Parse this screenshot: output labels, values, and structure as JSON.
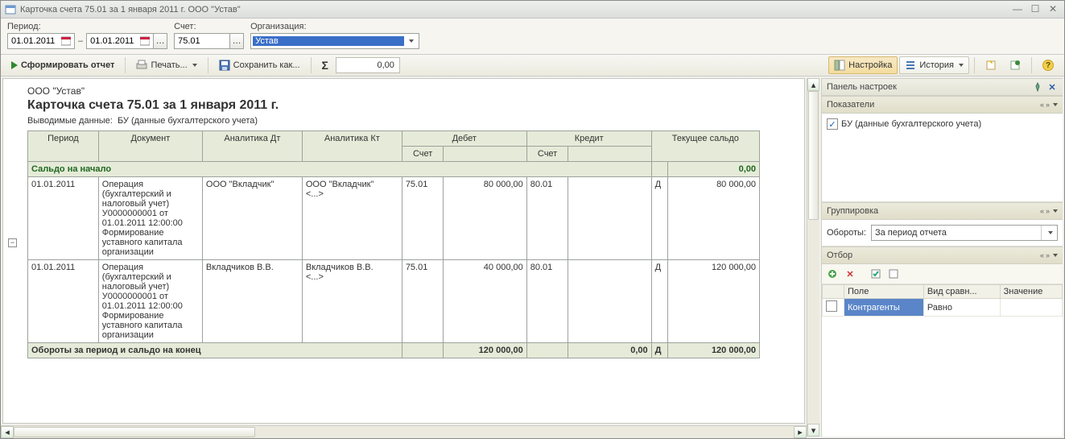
{
  "window": {
    "title": "Карточка счета 75.01 за 1 января 2011 г. ООО \"Устав\""
  },
  "filter": {
    "period_label": "Период:",
    "date_from": "01.01.2011",
    "date_to": "01.01.2011",
    "account_label": "Счет:",
    "account": "75.01",
    "org_label": "Организация:",
    "org": "Устав"
  },
  "toolbar": {
    "run": "Сформировать отчет",
    "print": "Печать...",
    "saveas": "Сохранить как...",
    "sigma": "Σ",
    "sum": "0,00",
    "settings": "Настройка",
    "history": "История"
  },
  "report": {
    "org": "ООО \"Устав\"",
    "title": "Карточка счета 75.01 за 1 января 2011 г.",
    "subtitle_label": "Выводимые данные:",
    "subtitle_value": "БУ (данные бухгалтерского учета)",
    "headers": {
      "period": "Период",
      "document": "Документ",
      "adt": "Аналитика Дт",
      "akt": "Аналитика Кт",
      "debit": "Дебет",
      "credit": "Кредит",
      "balance": "Текущее сальдо",
      "account": "Счет"
    },
    "start_row": {
      "label": "Сальдо на начало",
      "value": "0,00"
    },
    "rows": [
      {
        "date": "01.01.2011",
        "doc": "Операция (бухгалтерский и налоговый учет) У0000000001 от 01.01.2011 12:00:00\nФормирование уставного капитала организации",
        "adt": "ООО \"Вкладчик\"",
        "akt": "ООО \"Вкладчик\"\n<...>",
        "d_acc": "75.01",
        "d_val": "80 000,00",
        "k_acc": "80.01",
        "k_val": "",
        "b_type": "Д",
        "b_val": "80 000,00"
      },
      {
        "date": "01.01.2011",
        "doc": "Операция (бухгалтерский и налоговый учет) У0000000001 от 01.01.2011 12:00:00\nФормирование уставного капитала организации",
        "adt": "Вкладчиков В.В.",
        "akt": "Вкладчиков В.В.\n<...>",
        "d_acc": "75.01",
        "d_val": "40 000,00",
        "k_acc": "80.01",
        "k_val": "",
        "b_type": "Д",
        "b_val": "120 000,00"
      }
    ],
    "summary": {
      "label": "Обороты за период и сальдо на конец",
      "d_val": "120 000,00",
      "k_val": "0,00",
      "b_type": "Д",
      "b_val": "120 000,00"
    }
  },
  "panel": {
    "title": "Панель настроек",
    "indicators": {
      "title": "Показатели",
      "item": "БУ (данные бухгалтерского учета)"
    },
    "grouping": {
      "title": "Группировка",
      "turnover_label": "Обороты:",
      "turnover_value": "За период отчета"
    },
    "filter": {
      "title": "Отбор",
      "columns": {
        "field": "Поле",
        "cmp": "Вид сравн...",
        "value": "Значение"
      },
      "row": {
        "field": "Контрагенты",
        "cmp": "Равно",
        "value": ""
      }
    }
  }
}
